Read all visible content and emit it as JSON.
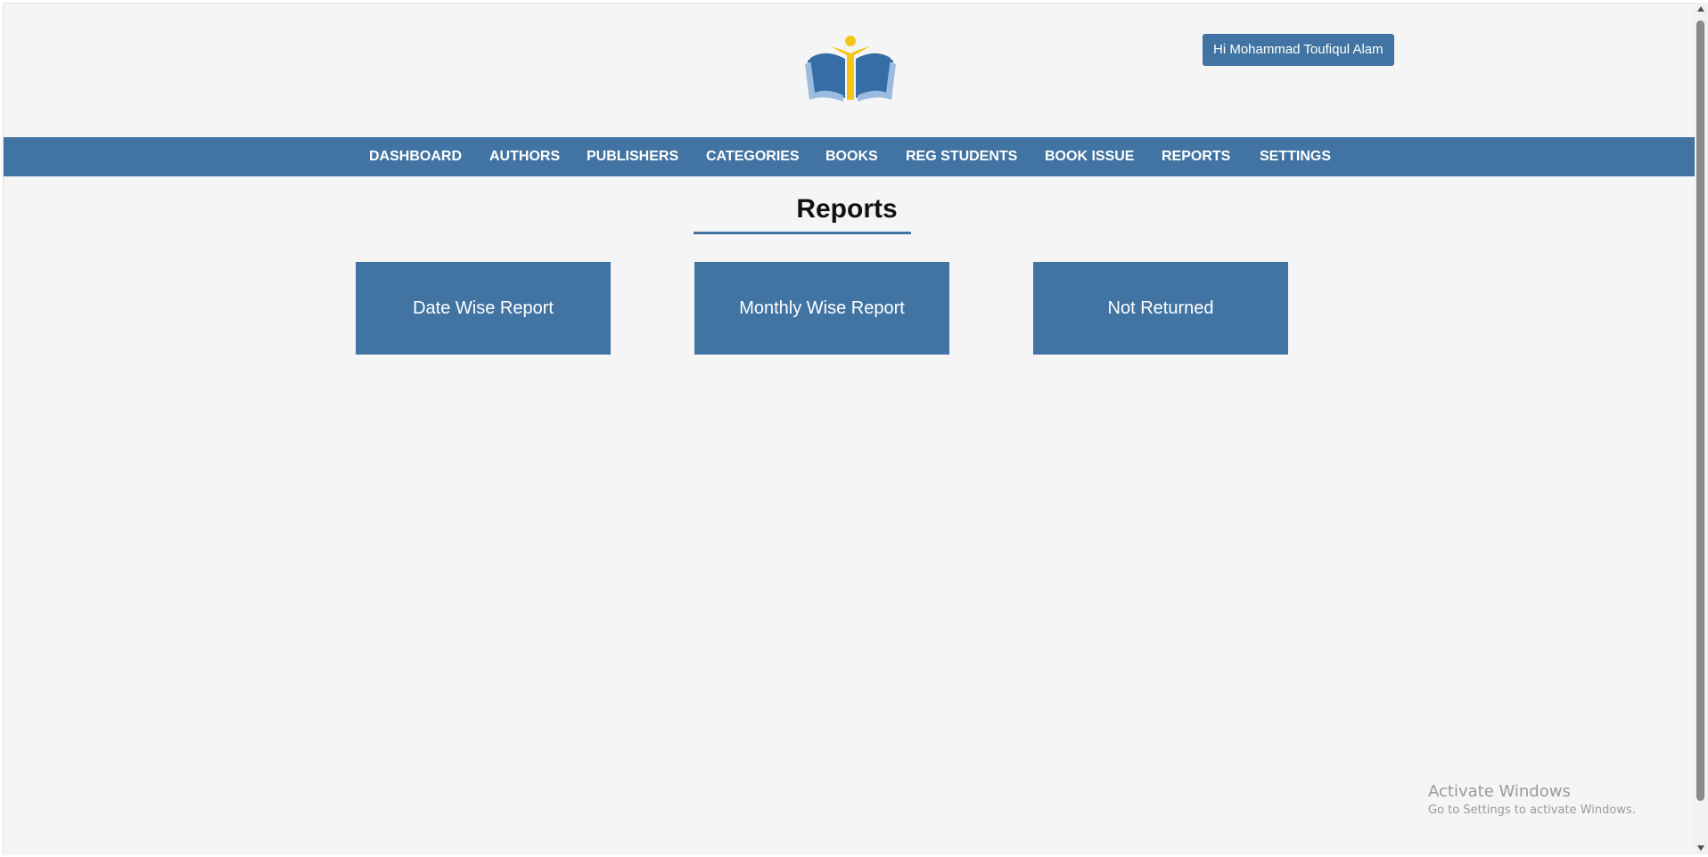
{
  "header": {
    "logo_icon": "open-book-reader-logo",
    "user_greeting": "Hi Mohammad Toufiqul Alam"
  },
  "nav": {
    "items": [
      {
        "label": "DASHBOARD"
      },
      {
        "label": "AUTHORS"
      },
      {
        "label": "PUBLISHERS"
      },
      {
        "label": "CATEGORIES"
      },
      {
        "label": "BOOKS"
      },
      {
        "label": "REG STUDENTS"
      },
      {
        "label": "BOOK ISSUE"
      },
      {
        "label": "REPORTS"
      },
      {
        "label": "SETTINGS"
      }
    ]
  },
  "main": {
    "title": "Reports",
    "cards": [
      {
        "label": "Date Wise Report"
      },
      {
        "label": "Monthly Wise Report"
      },
      {
        "label": "Not Returned"
      }
    ]
  },
  "watermark": {
    "title": "Activate Windows",
    "subtitle": "Go to Settings to activate Windows."
  },
  "colors": {
    "accent": "#4174a2",
    "background": "#f5f5f5",
    "logo_yellow": "#f5c518"
  }
}
